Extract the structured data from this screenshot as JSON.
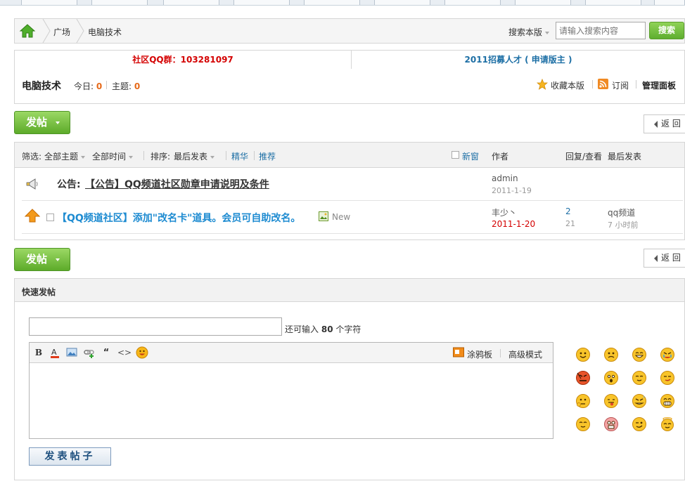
{
  "breadcrumb": {
    "items": [
      "广场",
      "电脑技术"
    ]
  },
  "search": {
    "scope_label": "搜索本版",
    "placeholder": "请输入搜索内容",
    "button_label": "搜索"
  },
  "notices": {
    "qq_group": "社区QQ群：103281097",
    "recruit": "2011招募人才 ( 申请版主 )"
  },
  "forum": {
    "name": "电脑技术",
    "today_label": "今日:",
    "today_value": "0",
    "topics_label": "主题:",
    "topics_value": "0",
    "favorite_label": "收藏本版",
    "subscribe_label": "订阅",
    "admin_panel_label": "管理面板"
  },
  "actions": {
    "post_label": "发帖",
    "back_label": "返 回"
  },
  "list_header": {
    "filter_label": "筛选:",
    "all_topics": "全部主题",
    "all_time": "全部时间",
    "sort_label": "排序:",
    "sort_value": "最后发表",
    "digest": "精华",
    "recommend": "推荐",
    "new_window": "新窗",
    "author_col": "作者",
    "reply_view_col": "回复/查看",
    "last_post_col": "最后发表"
  },
  "threads": [
    {
      "prefix": "公告:",
      "title": "【公告】QQ频道社区勋章申请说明及条件",
      "author": "admin",
      "date": "2011-1-19"
    },
    {
      "title": "【QQ频道社区】添加\"改名卡\"道具。会员可自助改名。",
      "badge": "New",
      "author": "丰少丶",
      "date": "2011-1-20",
      "replies": "2",
      "views": "21",
      "last_user": "qq频道",
      "last_time": "7 小时前"
    }
  ],
  "quick_post": {
    "title": "快速发帖",
    "remain_prefix": "还可输入",
    "remain_count": "80",
    "remain_suffix": "个字符",
    "doodle_label": "涂鸦板",
    "advanced_label": "高级模式",
    "submit_label": "发表帖子"
  },
  "colors": {
    "accent_green": "#5fae2f",
    "link_blue": "#1d6fa5",
    "notice_red": "#d40000",
    "count_orange": "#e66a1a"
  }
}
